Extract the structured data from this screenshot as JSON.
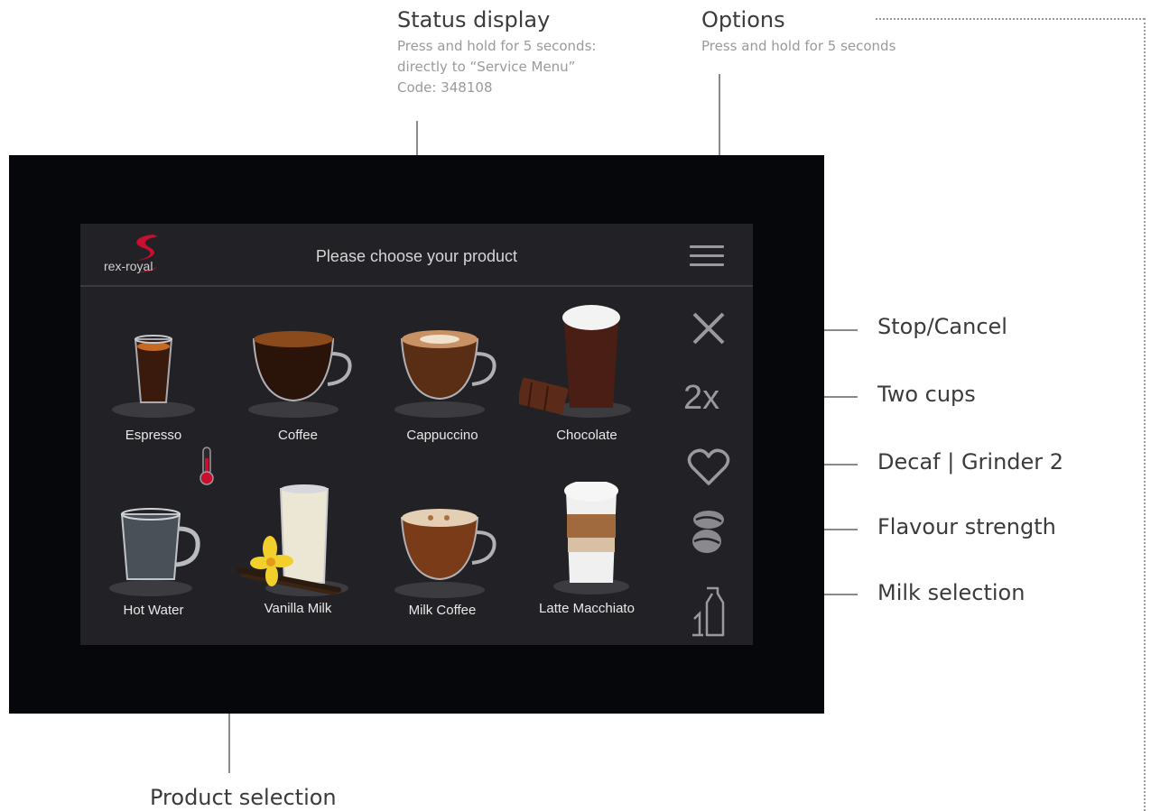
{
  "callouts": {
    "status_display": {
      "title": "Status display",
      "lines": [
        "Press and hold for 5 seconds:",
        "directly to “Service Menu”",
        "Code: 348108"
      ]
    },
    "options": {
      "title": "Options",
      "subtitle": "Press and hold for 5 seconds"
    },
    "stop_cancel": "Stop/Cancel",
    "two_cups": "Two cups",
    "decaf": "Decaf | Grinder 2",
    "flavour": "Flavour strength",
    "milk": "Milk selection",
    "product_selection": "Product selection"
  },
  "screen": {
    "logo_text": "rex-royal",
    "prompt": "Please choose your product",
    "products": [
      {
        "label": "Espresso",
        "icon": "espresso-glass-icon"
      },
      {
        "label": "Coffee",
        "icon": "coffee-cup-icon"
      },
      {
        "label": "Cappuccino",
        "icon": "cappuccino-cup-icon"
      },
      {
        "label": "Chocolate",
        "icon": "chocolate-glass-icon"
      },
      {
        "label": "Hot Water",
        "icon": "water-glass-icon"
      },
      {
        "label": "Vanilla Milk",
        "icon": "vanilla-milk-glass-icon"
      },
      {
        "label": "Milk Coffee",
        "icon": "milk-coffee-cup-icon"
      },
      {
        "label": "Latte Macchiato",
        "icon": "latte-macchiato-glass-icon"
      }
    ],
    "side_buttons": {
      "cancel_icon": "close-icon",
      "two_cups_label": "2x",
      "decaf_icon": "heart-icon",
      "strength_icon": "coffee-bean-icon",
      "milk_icon": "milk-carton-icon"
    }
  },
  "colors": {
    "screen_bg": "#222226",
    "device_bg": "#05070b",
    "accent_red": "#c8102e",
    "icon_grey": "#9a9a9e"
  }
}
